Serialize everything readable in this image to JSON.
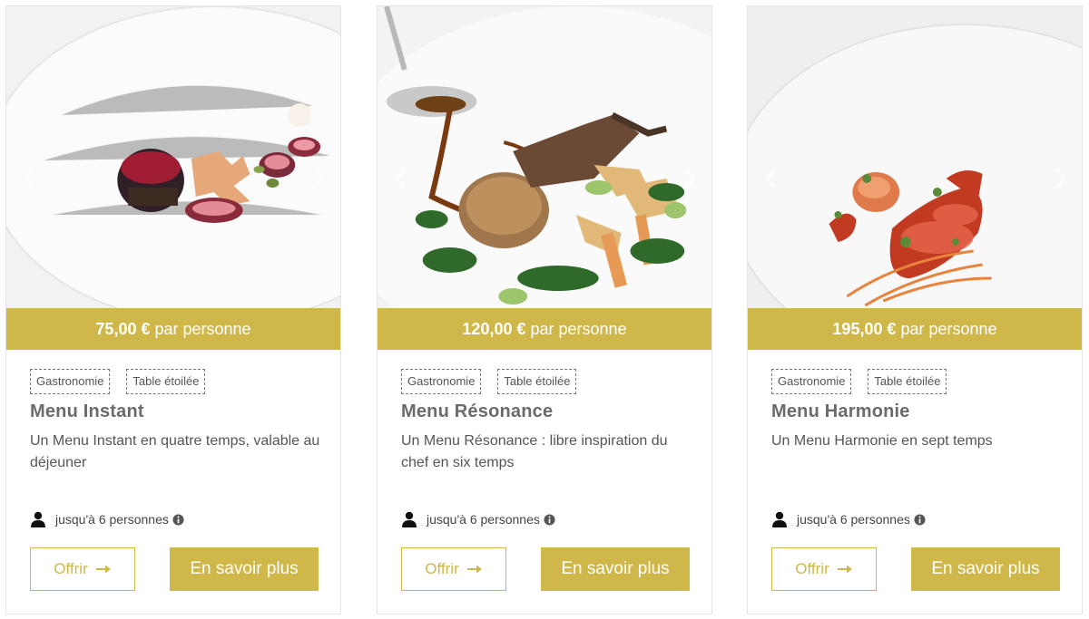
{
  "cards": [
    {
      "price_amount": "75,00 €",
      "price_unit": " par personne",
      "tags": [
        "Gastronomie",
        "Table étoilée"
      ],
      "title": "Menu Instant",
      "description": "Un Menu Instant en quatre temps, valable au déjeuner",
      "guests": "jusqu'à 6 personnes",
      "offer_label": "Offrir",
      "more_label": "En savoir plus",
      "image_alt": "Fig dessert plate"
    },
    {
      "price_amount": "120,00 €",
      "price_unit": " par personne",
      "tags": [
        "Gastronomie",
        "Table étoilée"
      ],
      "title": "Menu Résonance",
      "description": "Un Menu Résonance : libre inspiration du chef en six temps",
      "guests": "jusqu'à 6 personnes",
      "offer_label": "Offrir",
      "more_label": "En savoir plus",
      "image_alt": "Pigeon dish with sauce"
    },
    {
      "price_amount": "195,00 €",
      "price_unit": " par personne",
      "tags": [
        "Gastronomie",
        "Table étoilée"
      ],
      "title": "Menu Harmonie",
      "description": "Un Menu Harmonie en sept temps",
      "guests": "jusqu'à 6 personnes",
      "offer_label": "Offrir",
      "more_label": "En savoir plus",
      "image_alt": "Lobster with carrots"
    }
  ],
  "icons": {
    "prev": "chevron-left-icon",
    "next": "chevron-right-icon",
    "person": "person-icon",
    "info": "info-icon",
    "offer_arrow": "arrow-right-icon"
  },
  "colors": {
    "accent": "#cfb849",
    "border": "#e4e4e4",
    "text": "#555555"
  }
}
